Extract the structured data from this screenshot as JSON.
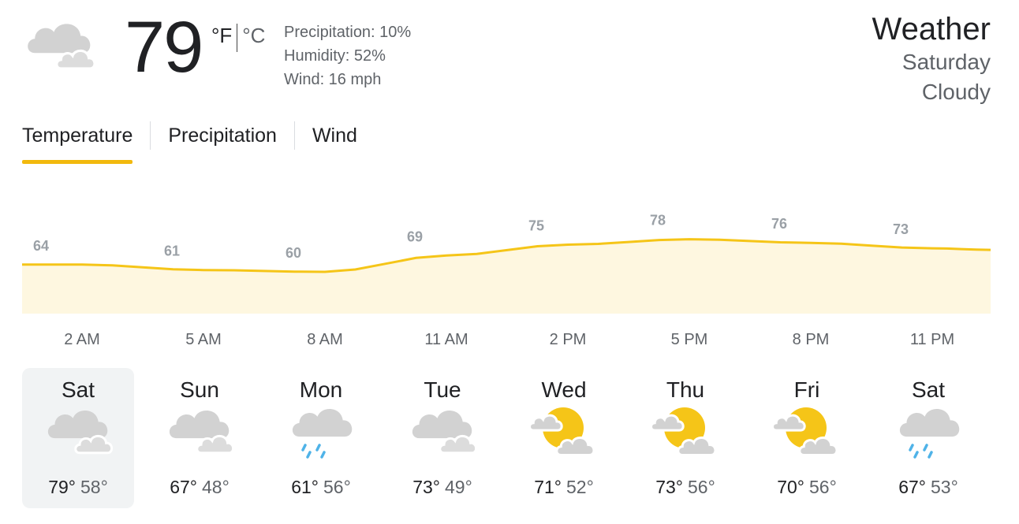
{
  "current": {
    "icon": "cloudy-icon",
    "temperature": "79",
    "unit_f": "°F",
    "unit_c": "°C",
    "precipitation": "Precipitation: 10%",
    "humidity": "Humidity: 52%",
    "wind": "Wind: 16 mph"
  },
  "header": {
    "title": "Weather",
    "day": "Saturday",
    "condition": "Cloudy"
  },
  "tabs": [
    {
      "label": "Temperature",
      "active": true
    },
    {
      "label": "Precipitation",
      "active": false
    },
    {
      "label": "Wind",
      "active": false
    }
  ],
  "colors": {
    "accent": "#f2b90d",
    "line": "#f5c518",
    "fill": "#fef7e0",
    "cloud": "#d2d2d2",
    "sun": "#f5c518",
    "rain": "#4fb3e8"
  },
  "chart_data": {
    "type": "area",
    "title": "",
    "x": [
      "2 AM",
      "5 AM",
      "8 AM",
      "11 AM",
      "2 PM",
      "5 PM",
      "8 PM",
      "11 PM"
    ],
    "values": [
      64,
      61,
      60,
      69,
      75,
      78,
      76,
      73
    ],
    "xlabel": "",
    "ylabel": "",
    "grid": false
  },
  "forecast": [
    {
      "day": "Sat",
      "icon": "cloudy-icon",
      "hi": "79°",
      "lo": "58°",
      "selected": true
    },
    {
      "day": "Sun",
      "icon": "cloudy-icon",
      "hi": "67°",
      "lo": "48°",
      "selected": false
    },
    {
      "day": "Mon",
      "icon": "rain-icon",
      "hi": "61°",
      "lo": "56°",
      "selected": false
    },
    {
      "day": "Tue",
      "icon": "cloudy-icon",
      "hi": "73°",
      "lo": "49°",
      "selected": false
    },
    {
      "day": "Wed",
      "icon": "partly-cloudy-icon",
      "hi": "71°",
      "lo": "52°",
      "selected": false
    },
    {
      "day": "Thu",
      "icon": "partly-cloudy-icon",
      "hi": "73°",
      "lo": "56°",
      "selected": false
    },
    {
      "day": "Fri",
      "icon": "partly-cloudy-icon",
      "hi": "70°",
      "lo": "56°",
      "selected": false
    },
    {
      "day": "Sat",
      "icon": "rain-icon",
      "hi": "67°",
      "lo": "53°",
      "selected": false
    }
  ]
}
